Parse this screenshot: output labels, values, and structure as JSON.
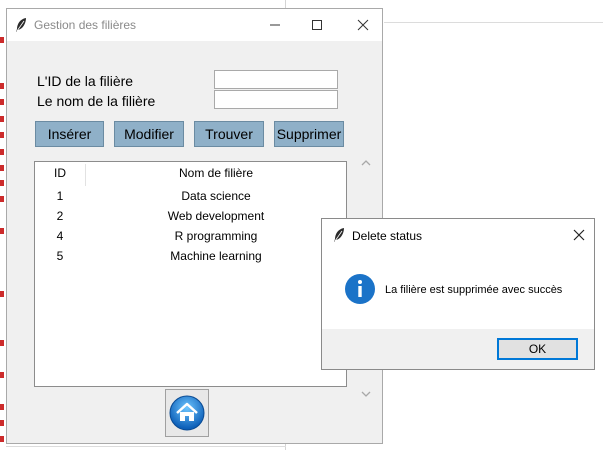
{
  "main_window": {
    "title": "Gestion des filières",
    "form": {
      "id_label": "L'ID de la filière",
      "id_value": "",
      "name_label": "Le nom de la filière",
      "name_value": ""
    },
    "buttons": {
      "insert": "Insérer",
      "modify": "Modifier",
      "find": "Trouver",
      "delete": "Supprimer"
    },
    "table": {
      "columns": [
        "ID",
        "Nom de filière"
      ],
      "rows": [
        {
          "id": "1",
          "name": "Data science"
        },
        {
          "id": "2",
          "name": "Web development"
        },
        {
          "id": "4",
          "name": "R programming"
        },
        {
          "id": "5",
          "name": "Machine learning"
        }
      ]
    },
    "home_icon": "home-icon"
  },
  "dialog": {
    "title": "Delete status",
    "icon": "info-icon",
    "message": "La filière est supprimée avec succès",
    "ok_label": "OK"
  },
  "colors": {
    "button_bg": "#8fb0c8",
    "ok_border": "#0078d7",
    "info_blue": "#1b73c8",
    "home_blue": "#1e88e5"
  }
}
